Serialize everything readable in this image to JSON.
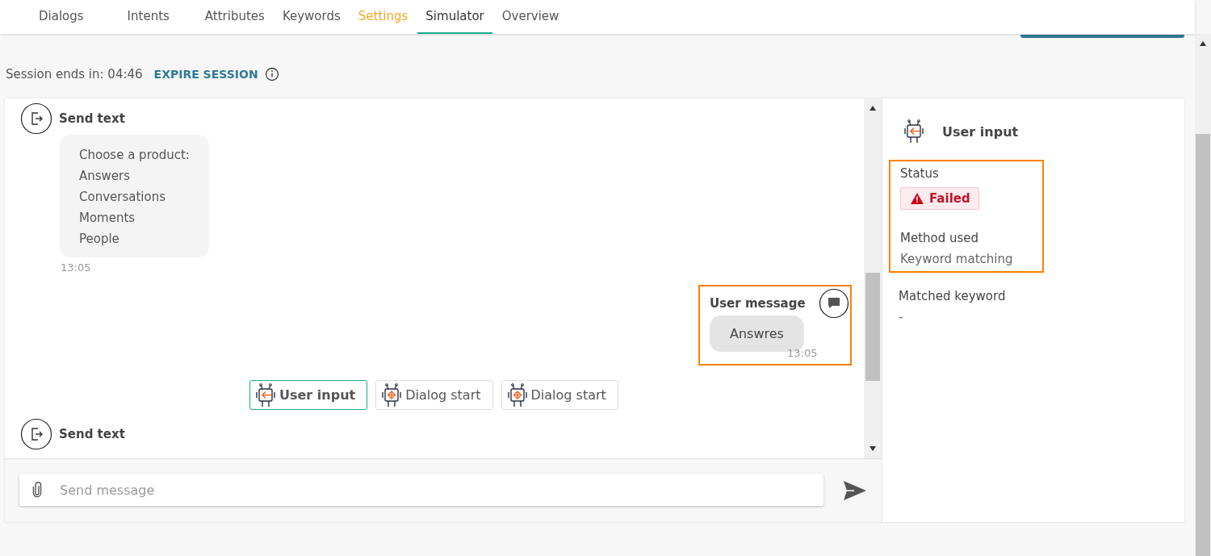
{
  "tabs": [
    {
      "label": "Dialogs",
      "selected": false,
      "kind": "normal"
    },
    {
      "label": "Intents",
      "selected": false,
      "kind": "normal"
    },
    {
      "label": "Attributes",
      "selected": false,
      "kind": "normal"
    },
    {
      "label": "Keywords",
      "selected": false,
      "kind": "normal"
    },
    {
      "label": "Settings",
      "selected": false,
      "kind": "accent"
    },
    {
      "label": "Simulator",
      "selected": true,
      "kind": "normal"
    },
    {
      "label": "Overview",
      "selected": false,
      "kind": "normal"
    }
  ],
  "session": {
    "label": "Session ends in: 04:46",
    "action": "EXPIRE SESSION"
  },
  "chat": {
    "messages": [
      {
        "kind": "bot",
        "title": "Send text",
        "lines": [
          "Choose a product:",
          "Answers",
          "Conversations",
          "Moments",
          "People"
        ],
        "time": "13:05"
      },
      {
        "kind": "user",
        "title": "User message",
        "lines": [
          "Answres"
        ],
        "time": "13:05",
        "highlighted": true
      },
      {
        "kind": "chips",
        "chips": [
          {
            "label": "User input",
            "selected": true,
            "kind": "input"
          },
          {
            "label": "Dialog start",
            "selected": false,
            "kind": "start"
          },
          {
            "label": "Dialog start",
            "selected": false,
            "kind": "start"
          }
        ]
      },
      {
        "kind": "bot",
        "title": "Send text"
      }
    ],
    "input": {
      "placeholder": "Send message"
    }
  },
  "details": {
    "title": "User input",
    "highlighted": true,
    "fields": [
      {
        "label": "Status",
        "kind": "badge",
        "value": "Failed"
      },
      {
        "label": "Method used",
        "kind": "text",
        "value": "Keyword matching"
      },
      {
        "label": "Matched keyword",
        "kind": "text",
        "value": "-"
      }
    ]
  }
}
